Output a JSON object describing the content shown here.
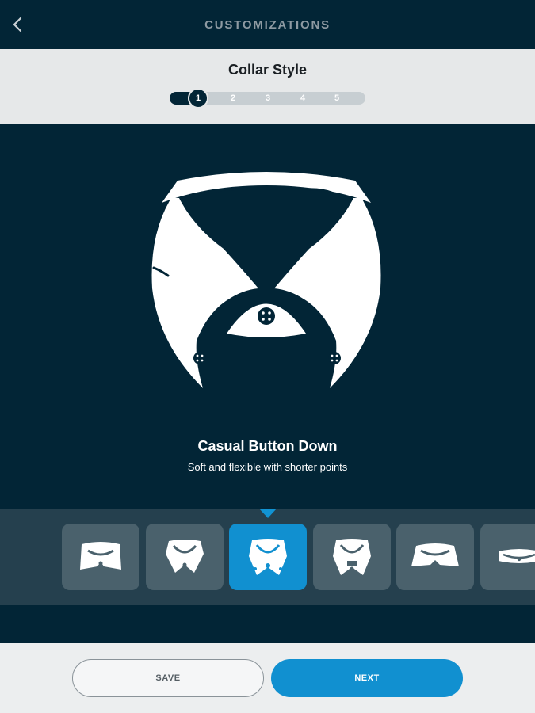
{
  "header": {
    "title": "CUSTOMIZATIONS",
    "back_icon": "chevron-left-icon"
  },
  "stepper": {
    "title": "Collar Style",
    "current_step": 1,
    "steps": [
      "1",
      "2",
      "3",
      "4",
      "5"
    ]
  },
  "selected_style": {
    "name": "Casual Button Down",
    "description": "Soft and flexible with shorter points",
    "icon": "button-down-collar-icon"
  },
  "options": [
    {
      "icon": "spread-collar-icon",
      "selected": false
    },
    {
      "icon": "point-collar-icon",
      "selected": false
    },
    {
      "icon": "button-down-collar-icon",
      "selected": true
    },
    {
      "icon": "tab-collar-icon",
      "selected": false
    },
    {
      "icon": "wide-spread-collar-icon",
      "selected": false
    },
    {
      "icon": "band-collar-icon",
      "selected": false
    }
  ],
  "footer": {
    "save_label": "SAVE",
    "next_label": "NEXT"
  },
  "colors": {
    "navy": "#022536",
    "accent_blue": "#1190d0",
    "panel_gray": "#e6e8e9",
    "option_gray": "#4a616c"
  }
}
